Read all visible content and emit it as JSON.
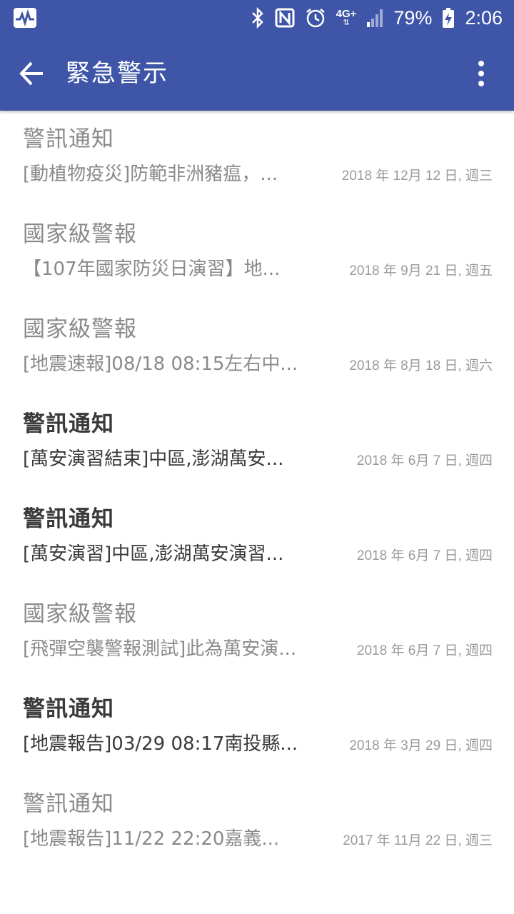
{
  "status_bar": {
    "battery_percent": "79%",
    "time": "2:06",
    "network_type": "4G+",
    "icons": [
      "activity-icon",
      "bluetooth-icon",
      "nfc-icon",
      "alarm-icon",
      "network-icon",
      "signal-icon",
      "battery-charging-icon"
    ]
  },
  "app_bar": {
    "title": "緊急警示",
    "back_icon": "arrow-back-icon",
    "menu_icon": "more-vert-icon"
  },
  "theme": {
    "primary": "#3f56a8",
    "read_text": "#8a8a8a",
    "unread_text": "#3a3a3a"
  },
  "alerts": [
    {
      "title": "警訊通知",
      "body": "[動植物疫災]防範非洲豬瘟，...",
      "date": "2018 年 12月 12 日, 週三",
      "unread": false
    },
    {
      "title": "國家級警報",
      "body": "【107年國家防災日演習】地...",
      "date": "2018 年 9月 21 日, 週五",
      "unread": false
    },
    {
      "title": "國家級警報",
      "body": "[地震速報]08/18 08:15左右中...",
      "date": "2018 年 8月 18 日, 週六",
      "unread": false
    },
    {
      "title": "警訊通知",
      "body": "[萬安演習結束]中區,澎湖萬安...",
      "date": "2018 年 6月 7 日, 週四",
      "unread": true
    },
    {
      "title": "警訊通知",
      "body": "[萬安演習]中區,澎湖萬安演習...",
      "date": "2018 年 6月 7 日, 週四",
      "unread": true
    },
    {
      "title": "國家級警報",
      "body": "[飛彈空襲警報測試]此為萬安演...",
      "date": "2018 年 6月 7 日, 週四",
      "unread": false
    },
    {
      "title": "警訊通知",
      "body": "[地震報告]03/29 08:17南投縣...",
      "date": "2018 年 3月 29 日, 週四",
      "unread": true
    },
    {
      "title": "警訊通知",
      "body": "[地震報告]11/22 22:20嘉義...",
      "date": "2017 年 11月 22 日, 週三",
      "unread": false
    }
  ]
}
